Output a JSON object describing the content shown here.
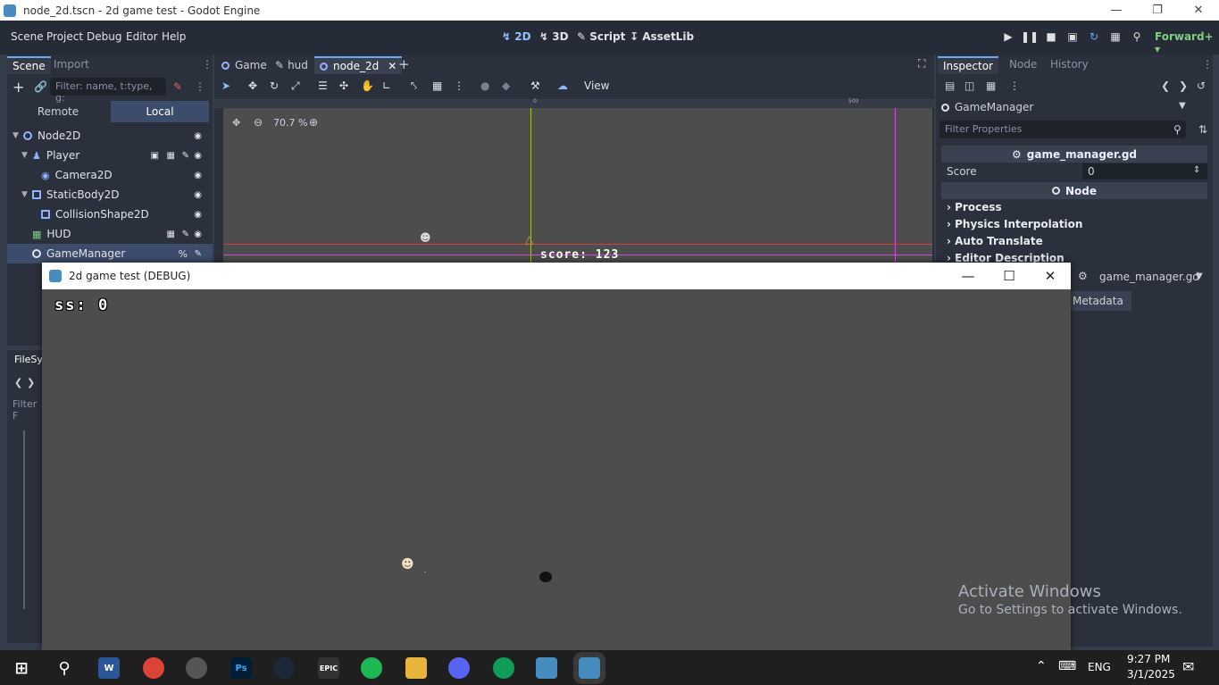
{
  "window": {
    "title": "node_2d.tscn - 2d game test - Godot Engine"
  },
  "menu": [
    "Scene",
    "Project",
    "Debug",
    "Editor",
    "Help"
  ],
  "modes": {
    "m2d": "2D",
    "m3d": "3D",
    "script": "Script",
    "assetlib": "AssetLib"
  },
  "renderer": "Forward+",
  "scene_dock": {
    "tabs": [
      "Scene",
      "Import"
    ],
    "filter_placeholder": "Filter: name, t:type, g:",
    "remote": "Remote",
    "local": "Local",
    "tree": [
      {
        "label": "Node2D"
      },
      {
        "label": "Player"
      },
      {
        "label": "Camera2D"
      },
      {
        "label": "StaticBody2D"
      },
      {
        "label": "CollisionShape2D"
      },
      {
        "label": "HUD"
      },
      {
        "label": "GameManager"
      }
    ]
  },
  "filesystem": {
    "tab": "FileSys",
    "filter": "Filter F"
  },
  "editor_tabs": [
    "Game",
    "hud",
    "node_2d"
  ],
  "toolbar": {
    "view": "View"
  },
  "viewport": {
    "zoom": "70.7 %",
    "ruler_0": "0",
    "ruler_500": "500",
    "score_label": "score: 123"
  },
  "inspector": {
    "tabs": [
      "Inspector",
      "Node",
      "History"
    ],
    "object": "GameManager",
    "filter_placeholder": "Filter Properties",
    "script_header": "game_manager.gd",
    "score_label": "Score",
    "score_value": "0",
    "node_header": "Node",
    "sections": [
      "Process",
      "Physics Interpolation",
      "Auto Translate",
      "Editor Description"
    ],
    "script_field": "game_manager.gd",
    "metadata": "Metadata"
  },
  "debug_window": {
    "title": "2d game test (DEBUG)",
    "hud_text": "ss: 0"
  },
  "activate": {
    "line1": "Activate Windows",
    "line2": "Go to Settings to activate Windows."
  },
  "taskbar": {
    "lang": "ENG",
    "time": "9:27 PM",
    "date": "3/1/2025"
  },
  "colors": {
    "accent": "#6fa8f0",
    "godot_blue": "#478cbf",
    "viewport_bg": "#4d4d4d"
  }
}
